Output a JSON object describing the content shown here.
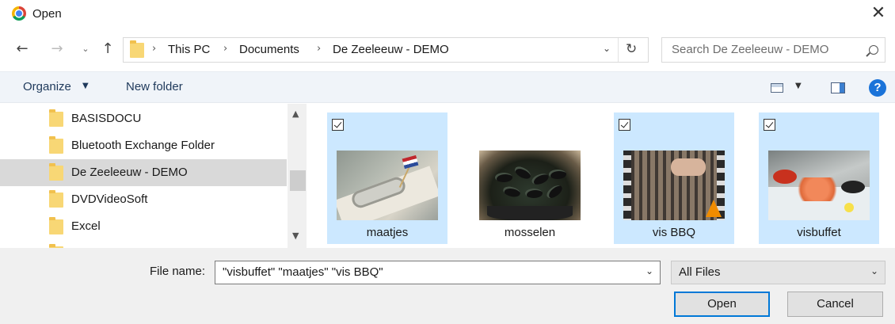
{
  "window": {
    "title": "Open",
    "close_icon": "close-icon"
  },
  "nav": {
    "back_icon": "arrow-left-icon",
    "forward_icon": "arrow-right-icon",
    "recent_icon": "chevron-down-icon",
    "up_icon": "arrow-up-icon",
    "breadcrumbs": [
      "This PC",
      "Documents",
      "De Zeeleeuw - DEMO"
    ],
    "search_placeholder": "Search De Zeeleeuw - DEMO"
  },
  "toolbar": {
    "organize_label": "Organize",
    "new_folder_label": "New folder"
  },
  "tree": {
    "items": [
      {
        "label": "BASISDOCU",
        "selected": false
      },
      {
        "label": "Bluetooth Exchange Folder",
        "selected": false
      },
      {
        "label": "De Zeeleeuw - DEMO",
        "selected": true
      },
      {
        "label": "DVDVideoSoft",
        "selected": false
      },
      {
        "label": "Excel",
        "selected": false
      }
    ]
  },
  "files": [
    {
      "name": "maatjes",
      "selected": true,
      "checked": true
    },
    {
      "name": "mosselen",
      "selected": false,
      "checked": false
    },
    {
      "name": "vis BBQ",
      "selected": true,
      "checked": true
    },
    {
      "name": "visbuffet",
      "selected": true,
      "checked": true
    }
  ],
  "footer": {
    "file_name_label": "File name:",
    "file_name_value": "\"visbuffet\" \"maatjes\" \"vis BBQ\"",
    "file_type_value": "All Files",
    "open_label": "Open",
    "cancel_label": "Cancel"
  },
  "colors": {
    "selection": "#cce8ff",
    "accent": "#0078d7",
    "folder": "#f8d775"
  }
}
